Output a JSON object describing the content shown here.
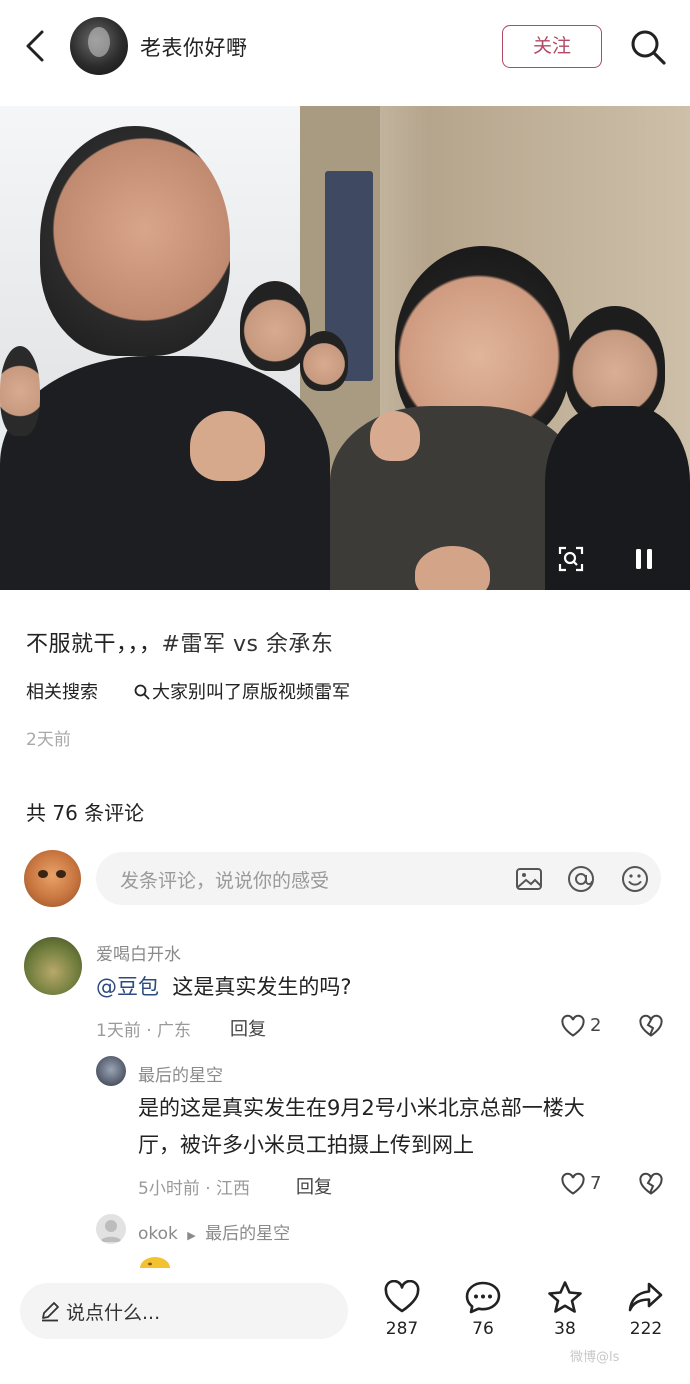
{
  "header": {
    "author": "老表你好嘢",
    "follow_label": "关注"
  },
  "post": {
    "caption_text": "不服就干，，，",
    "hashtag": "#雷军 vs 余承东",
    "related_label": "相关搜索",
    "related_query": "大家别叫了原版视频雷军",
    "time": "2天前"
  },
  "comments_header": "共 76 条评论",
  "comment_input": {
    "placeholder": "发条评论，说说你的感受"
  },
  "comments": [
    {
      "name": "爱喝白开水",
      "mention": "@豆包",
      "text": "这是真实发生的吗?",
      "meta": "1天前 · 广东",
      "reply_label": "回复",
      "likes": "2"
    },
    {
      "name": "最后的星空",
      "text_line1": "是的这是真实发生在9月2号小米北京总部一楼大",
      "text_line2": "厅，被许多小米员工拍摄上传到网上",
      "meta": "5小时前 · 江西",
      "reply_label": "回复",
      "likes": "7"
    },
    {
      "name": "okok",
      "reply_to": "最后的星空"
    }
  ],
  "bottom_bar": {
    "say_placeholder": "说点什么...",
    "likes": "287",
    "comments": "76",
    "stars": "38",
    "shares": "222"
  },
  "watermark": "微博@ls",
  "icons": [
    "back-icon",
    "search-icon",
    "scan-icon",
    "pause-icon",
    "image-icon",
    "at-icon",
    "emoji-icon",
    "heart-icon",
    "broken-heart-icon",
    "pen-icon",
    "comment-icon",
    "star-icon",
    "share-icon"
  ],
  "colors": {
    "accent": "#b04a67",
    "mention": "#2b4a7f"
  }
}
